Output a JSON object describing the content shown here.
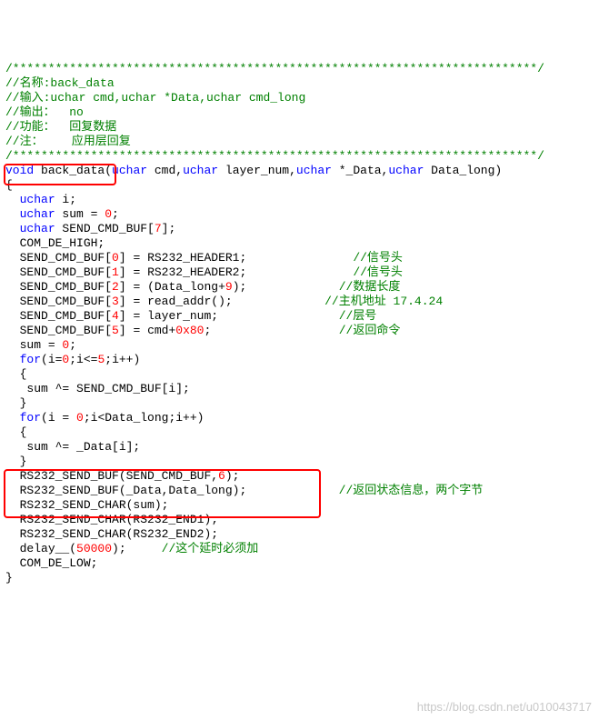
{
  "c": {
    "sep1": "/**************************************************************************/",
    "name": "//名称:back_data",
    "in": "//输入:uchar cmd,uchar *Data,uchar cmd_long",
    "out": "//输出：  no",
    "fun": "//功能：  回复数据",
    "note": "//注：    应用层回复",
    "sep2": "/**************************************************************************/",
    "c_sig": "//信号头",
    "c_len": "//数据长度",
    "c_addr": "//主机地址 17.4.24",
    "c_layer": "//层号",
    "c_ret": "//返回命令",
    "c_stat": "//返回状态信息，两个字节",
    "c_delay": "//这个延时必须加"
  },
  "t": {
    "void": "void",
    "uchar": "uchar",
    "for": "for",
    "fn": " back_data(",
    "p1": " cmd,",
    "p2": " layer_num,",
    "p3": " *_Data,",
    "p4": " Data_long)",
    "lb": "{",
    "rb": "}",
    "ind": "  ",
    "ind2": "   ",
    "decl_i": " i;",
    "decl_sum": " sum = ",
    "zero": "0",
    "semi": ";",
    "decl_buf": " SEND_CMD_BUF[",
    "seven": "7",
    "rbr": "];",
    "com_de_high": "COM_DE_HIGH;",
    "sb0": "SEND_CMD_BUF[",
    "idx0": "0",
    "idx1": "1",
    "idx2": "2",
    "idx3": "3",
    "idx4": "4",
    "idx5": "5",
    "rb_eq": "] = ",
    "h1": "RS232_HEADER1;",
    "h2": "RS232_HEADER2;",
    "dl": "(Data_long+",
    "nine": "9",
    "dle": ");",
    "readaddr": "read_addr();",
    "layernum": "layer_num;",
    "cmd80": "cmd+",
    "x80": "0x80",
    "sum0": "sum = ",
    "for1a": "(i=",
    "for1b": ";i<=",
    "five": "5",
    "for1c": ";i++)",
    "sumxor": "sum ^= SEND_CMD_BUF[i];",
    "for2a": "(i = ",
    "for2b": ";i<Data_long;i++)",
    "sumxor2": "sum ^= _Data[i];",
    "rs1": "RS232_SEND_BUF(SEND_CMD_BUF,",
    "six": "6",
    "rs1e": ");",
    "rs2": "RS232_SEND_BUF(_Data,Data_long);",
    "rs3": "RS232_SEND_CHAR(sum);",
    "rs4": "RS232_SEND_CHAR(RS232_END1);",
    "rs5": "RS232_SEND_CHAR(RS232_END2);",
    "delay1": "delay__(",
    "d50000": "50000",
    "delay2": ");",
    "com_de_low": "COM_DE_LOW;",
    "sp_sig": "               ",
    "sp_len": "             ",
    "sp_addr": "             ",
    "sp_layer": "                 ",
    "sp_ret": "                  ",
    "sp_stat": "             ",
    "sp_delay": "     "
  },
  "wm": "https://blog.csdn.net/u010043717"
}
